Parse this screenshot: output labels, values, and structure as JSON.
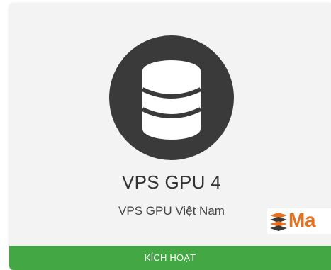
{
  "card": {
    "title": "VPS GPU 4",
    "subtitle": "VPS GPU Việt Nam",
    "icon": "database-icon",
    "button_label": "KÍCH HOẠT",
    "logo_text": "Ma",
    "colors": {
      "icon_circle": "#3a3a3a",
      "button": "#43a843",
      "logo": "#e8711f"
    }
  }
}
